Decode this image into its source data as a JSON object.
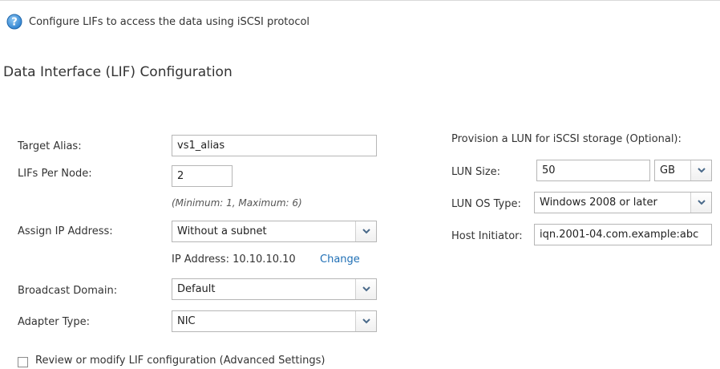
{
  "intro": {
    "text": "Configure LIFs to access the data using iSCSI protocol",
    "help_icon": "question-circle-icon"
  },
  "section": {
    "title": "Data Interface (LIF) Configuration"
  },
  "form": {
    "target_alias": {
      "label": "Target Alias:",
      "value": "vs1_alias"
    },
    "lifs_per_node": {
      "label": "LIFs Per Node:",
      "value": "2",
      "hint": "(Minimum: 1, Maximum: 6)"
    },
    "assign_ip": {
      "label": "Assign IP Address:",
      "value": "Without a subnet",
      "ip_text": "IP Address: 10.10.10.10",
      "change_label": "Change"
    },
    "broadcast_domain": {
      "label": "Broadcast Domain:",
      "value": "Default"
    },
    "adapter_type": {
      "label": "Adapter Type:",
      "value": "NIC"
    }
  },
  "lun": {
    "heading": "Provision a LUN for iSCSI storage (Optional):",
    "size": {
      "label": "LUN Size:",
      "value": "50",
      "unit": "GB"
    },
    "os_type": {
      "label": "LUN OS Type:",
      "value": "Windows 2008 or later"
    },
    "host_initiator": {
      "label": "Host Initiator:",
      "value": "iqn.2001-04.com.example:abc"
    }
  },
  "advanced": {
    "label": "Review or modify LIF configuration (Advanced Settings)",
    "checked": false
  },
  "colors": {
    "link": "#1f6fb5",
    "help_icon": "#3b8fd6",
    "border": "#b6b6b6"
  }
}
